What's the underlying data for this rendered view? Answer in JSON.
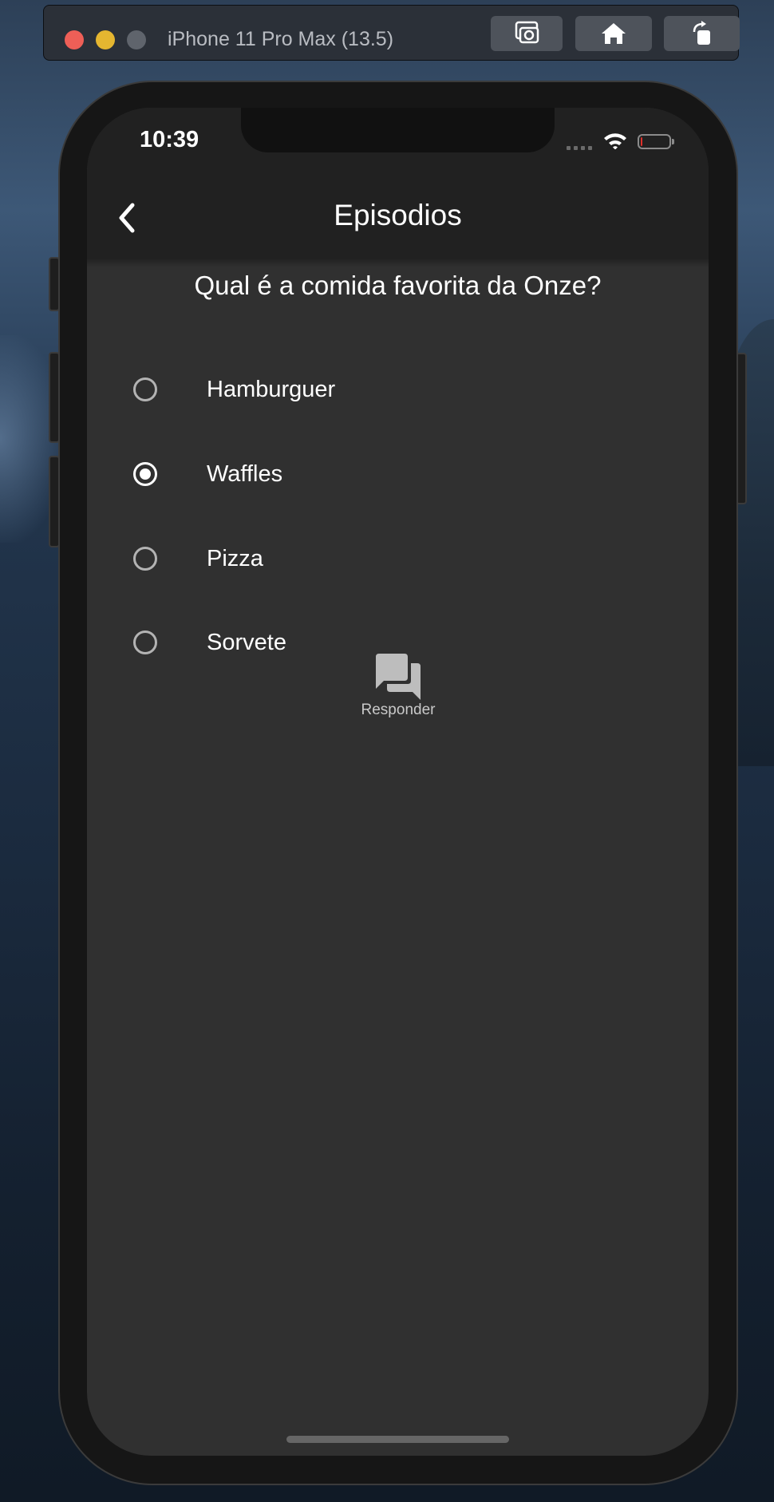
{
  "simulator": {
    "device_title": "iPhone 11 Pro Max (13.5)",
    "buttons": [
      "screenshot",
      "home",
      "rotate"
    ]
  },
  "status_bar": {
    "time": "10:39",
    "battery_level": 0.05,
    "battery_color": "#e0312b"
  },
  "app_bar": {
    "title": "Episodios",
    "back_icon": "chevron-left-icon"
  },
  "quiz": {
    "question": "Qual é a comida favorita da Onze?",
    "options": [
      {
        "label": "Hamburguer",
        "selected": false
      },
      {
        "label": "Waffles",
        "selected": true
      },
      {
        "label": "Pizza",
        "selected": false
      },
      {
        "label": "Sorvete",
        "selected": false
      }
    ],
    "answer_button": {
      "label": "Responder",
      "icon": "question-answer-icon"
    }
  },
  "colors": {
    "screen_background": "#303030",
    "app_bar_background": "#212121",
    "text": "#ffffff",
    "radio_unselected": "#b3b3b3",
    "answer_icon": "#bdbdbd"
  }
}
